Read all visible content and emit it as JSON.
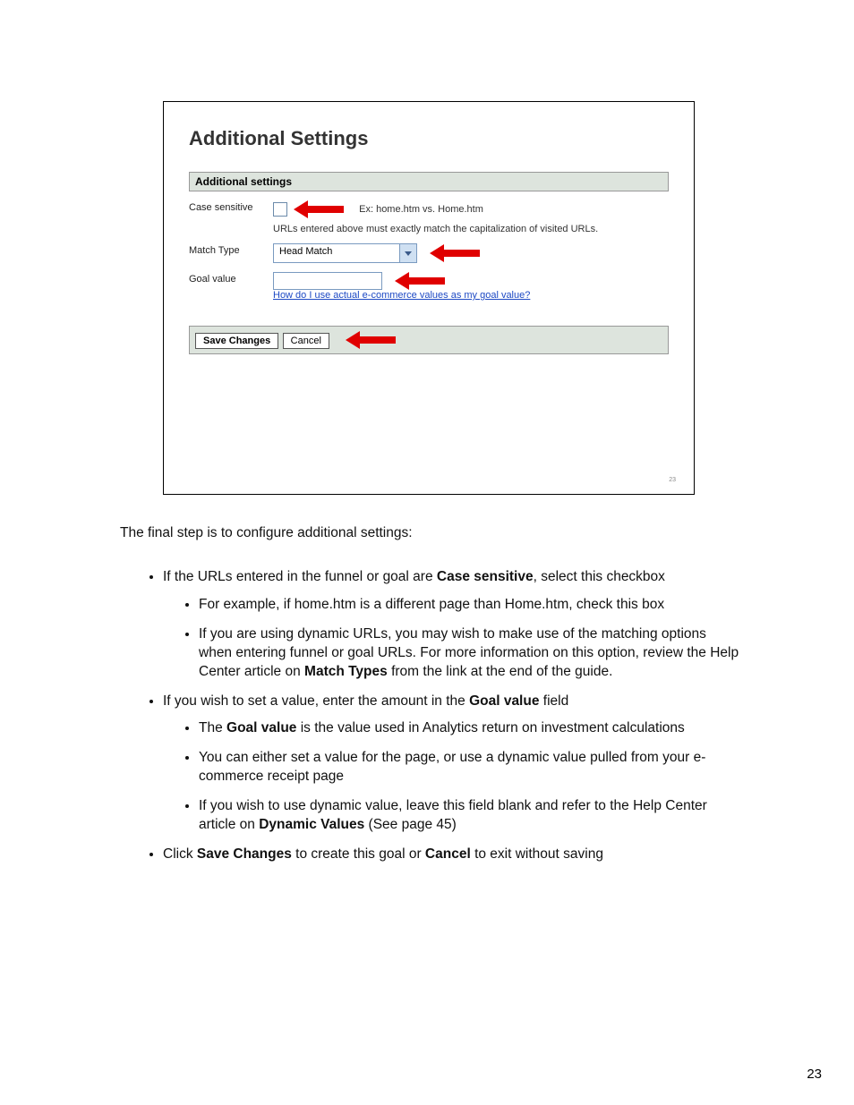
{
  "slide": {
    "title": "Additional Settings",
    "section_header": "Additional settings",
    "rows": {
      "case_sensitive": {
        "label": "Case sensitive",
        "example": "Ex: home.htm vs. Home.htm",
        "note": "URLs entered above must exactly match the capitalization of visited URLs."
      },
      "match_type": {
        "label": "Match Type",
        "value": "Head Match"
      },
      "goal_value": {
        "label": "Goal value",
        "link": "How do I use actual e-commerce values as my goal value?"
      }
    },
    "buttons": {
      "save": "Save Changes",
      "cancel": "Cancel"
    },
    "page_number": "23"
  },
  "body": {
    "intro": "The final step is to configure additional settings:",
    "b1_pre": "If the URLs entered in the funnel or goal are ",
    "b1_bold": "Case sensitive",
    "b1_post": ", select this checkbox",
    "b1a": "For example, if home.htm is a different page than Home.htm, check this box",
    "b1b_pre": "If you are using dynamic URLs, you may wish to make use of the matching options when entering funnel or goal URLs. For more information on this option, review the Help Center article on ",
    "b1b_bold": "Match Types",
    "b1b_post": " from the link at the end of the guide.",
    "b2_pre": "If you wish to set a value, enter the amount in the ",
    "b2_bold": "Goal value",
    "b2_post": " field",
    "b2a_pre": "The ",
    "b2a_bold": "Goal value",
    "b2a_post": " is the value used in Analytics return on investment calculations",
    "b2b": "You can either set a value for the page, or use a dynamic value pulled from your e-commerce receipt page",
    "b2c_pre": "If you wish to use dynamic value, leave this field blank and refer to the Help Center article on ",
    "b2c_bold": "Dynamic Values",
    "b2c_post": "  (See page 45)",
    "b3_pre": "Click ",
    "b3_bold1": "Save Changes",
    "b3_mid": " to create this goal or ",
    "b3_bold2": "Cancel",
    "b3_post": " to exit without saving"
  },
  "page_number": "23"
}
